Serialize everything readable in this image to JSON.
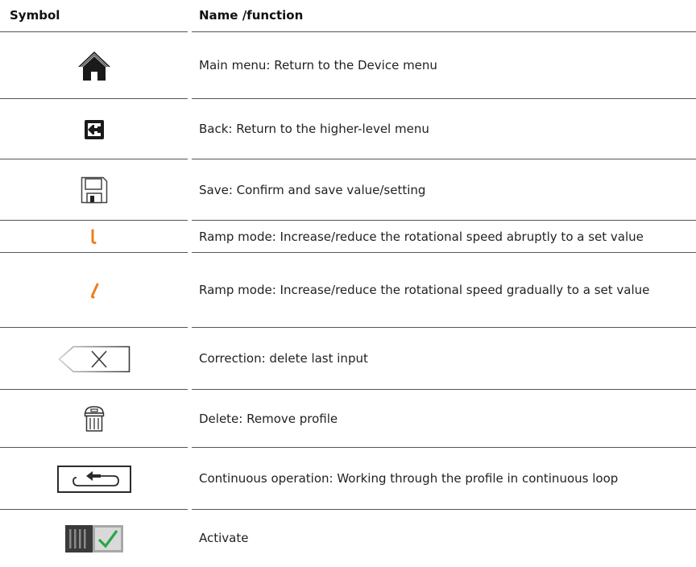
{
  "header": {
    "symbol": "Symbol",
    "name_function": "Name /function"
  },
  "rows": [
    {
      "icon": "home-icon",
      "description": "Main menu: Return to the Device menu"
    },
    {
      "icon": "back-exit-icon",
      "description": "Back: Return to the higher-level menu"
    },
    {
      "icon": "save-floppy-icon",
      "description": "Save: Confirm and save value/setting"
    },
    {
      "icon": "ramp-abrupt-icon",
      "description": "Ramp mode: Increase/reduce the rotational speed abruptly to a set value"
    },
    {
      "icon": "ramp-gradual-icon",
      "description": "Ramp mode: Increase/reduce the rotational speed gradually to a set value"
    },
    {
      "icon": "backspace-delete-icon",
      "description": "Correction: delete last input"
    },
    {
      "icon": "trash-bin-icon",
      "description": "Delete: Remove profile"
    },
    {
      "icon": "loop-return-icon",
      "description": "Continuous operation: Working through the profile in continuous loop"
    },
    {
      "icon": "activate-check-icon",
      "description": "Activate"
    }
  ],
  "colors": {
    "ramp_orange": "#f07d1a",
    "check_green": "#28a745",
    "text": "#222222",
    "rule": "#555555"
  }
}
